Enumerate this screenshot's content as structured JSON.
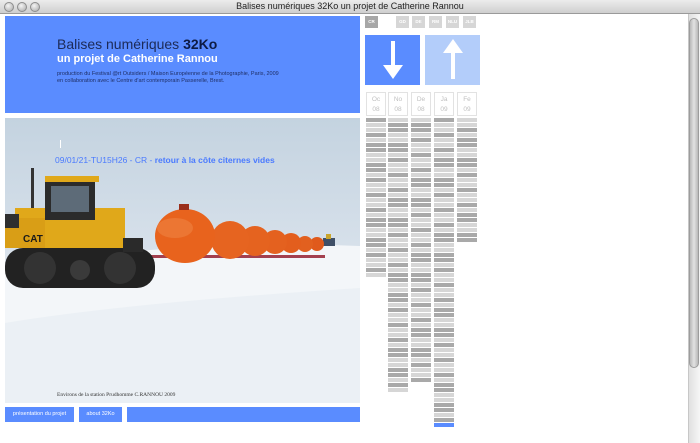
{
  "window": {
    "title": "Balises numériques 32Ko un projet de Catherine Rannou"
  },
  "header": {
    "title_plain": "Balises numériques ",
    "title_bold": "32Ko",
    "subtitle": "un projet de Catherine Rannou",
    "credit_line1": "production du Festival @rt Outsiders / Maison Européenne de la Photographie, Paris, 2009",
    "credit_line2": "en collaboration avec le Centre d'art contemporain Passerelle, Brest."
  },
  "photo": {
    "caption_prefix": "09/01/21-TU15H26 - CR - ",
    "caption_title": "retour à la côte citernes vides",
    "credit": "Environs de la station Prudhomme C.RANNOU 2009",
    "vehicle_brand": "CAT"
  },
  "buttons": {
    "presentation": "présentation du projet",
    "about": "about 32Ko"
  },
  "tabs": [
    {
      "label": "CR",
      "active": true
    },
    {
      "label": "GD",
      "active": false
    },
    {
      "label": "DE",
      "active": false
    },
    {
      "label": "RM",
      "active": false
    },
    {
      "label": "NLU",
      "active": false
    },
    {
      "label": "JLB",
      "active": false
    }
  ],
  "arrows": {
    "down_color": "#5a8cff",
    "up_color": "#b3cdfa"
  },
  "months": [
    {
      "name": "Oc",
      "year": "08"
    },
    {
      "name": "No",
      "year": "08"
    },
    {
      "name": "De",
      "year": "08"
    },
    {
      "name": "Ja",
      "year": "09"
    },
    {
      "name": "Fe",
      "year": "09"
    }
  ],
  "colors": {
    "accent": "#5a8cff",
    "caption": "#4a7aff",
    "cell_light": "#d6d6d6",
    "cell_dark": "#a9a9a9"
  }
}
